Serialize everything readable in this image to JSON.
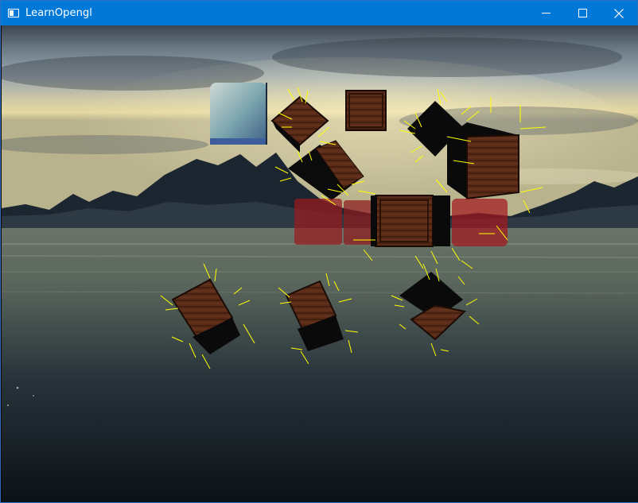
{
  "window": {
    "title": "LearnOpengl",
    "accent_color": "#0078d7",
    "icons": {
      "app": "window-app-icon",
      "minimize": "minimize-icon",
      "maximize": "maximize-icon",
      "close": "close-icon"
    }
  },
  "scene": {
    "skybox": "lake-mountain-sunset",
    "objects": [
      "wooden-crate-cube",
      "red-glass-window",
      "normal-visualization-lines",
      "reflective-cube"
    ],
    "normal_line_color": "#ffff00"
  }
}
